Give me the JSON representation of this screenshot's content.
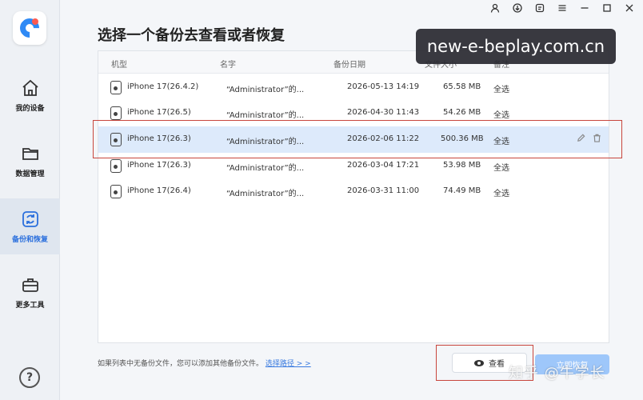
{
  "sidebar": {
    "items": [
      {
        "label": "我的设备",
        "icon": "home-icon",
        "active": false
      },
      {
        "label": "数据管理",
        "icon": "folder-icon",
        "active": false
      },
      {
        "label": "备份和恢复",
        "icon": "backup-restore-icon",
        "active": true
      },
      {
        "label": "更多工具",
        "icon": "toolbox-icon",
        "active": false
      }
    ],
    "help": "?"
  },
  "window_controls": [
    "user-icon",
    "download-icon",
    "note-icon",
    "menu-icon",
    "minimize-icon",
    "close-icon"
  ],
  "page": {
    "title": "选择一个备份去查看或者恢复",
    "hint_text": "如果列表中无备份文件，您可以添加其他备份文件。",
    "hint_link": "选择路径 > >"
  },
  "table": {
    "columns": [
      "机型",
      "名字",
      "备份日期",
      "文件大小",
      "备注"
    ],
    "rows": [
      {
        "model": "iPhone 17(26.4.2)",
        "name": "“Administrator”的...",
        "date": "2026-05-13 14:19",
        "size": "65.58 MB",
        "note": "全选",
        "selected": false
      },
      {
        "model": "iPhone 17(26.5)",
        "name": "“Administrator”的...",
        "date": "2026-04-30 11:43",
        "size": "54.26 MB",
        "note": "全选",
        "selected": false
      },
      {
        "model": "iPhone 17(26.3)",
        "name": "“Administrator”的...",
        "date": "2026-02-06 11:22",
        "size": "500.36 MB",
        "note": "全选",
        "selected": true
      },
      {
        "model": "iPhone 17(26.3)",
        "name": "“Administrator”的...",
        "date": "2026-03-04 17:21",
        "size": "53.98 MB",
        "note": "全选",
        "selected": false
      },
      {
        "model": "iPhone 17(26.4)",
        "name": "“Administrator”的...",
        "date": "2026-03-31 11:00",
        "size": "74.49 MB",
        "note": "全选",
        "selected": false
      }
    ],
    "row_actions": [
      "edit-icon",
      "delete-icon"
    ]
  },
  "buttons": {
    "view": "查看",
    "restore": "立即恢复"
  },
  "watermarks": {
    "top": "new-e-beplay.com.cn",
    "bottom": "知乎 @牛学长"
  },
  "colors": {
    "accent": "#2a6fdd",
    "selected_row": "#ddeafb",
    "highlight_box": "#c8463d",
    "restore_button": "#9ec7fa"
  }
}
